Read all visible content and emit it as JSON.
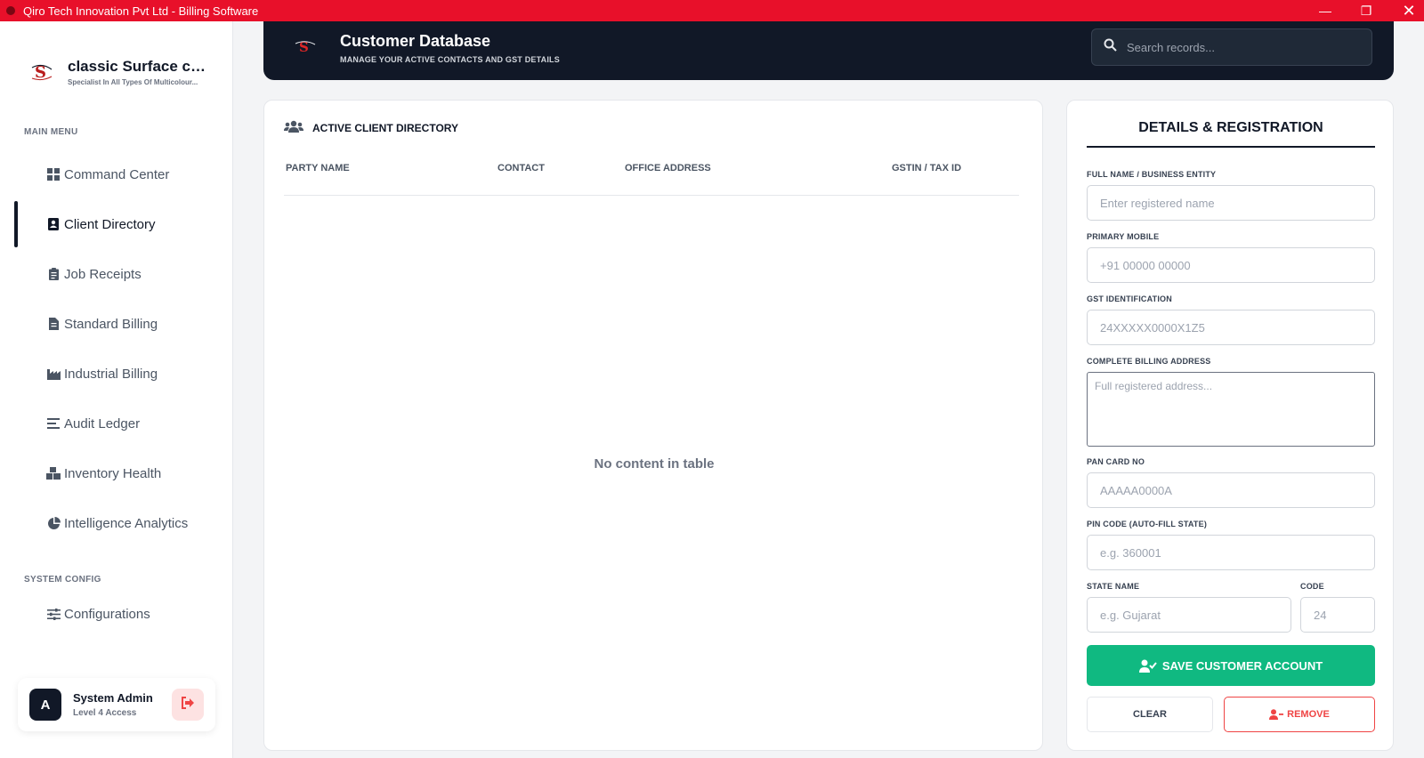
{
  "window": {
    "title": "Qiro Tech Innovation Pvt Ltd - Billing Software",
    "controls": [
      "minimize",
      "restore",
      "close"
    ]
  },
  "brand": {
    "name": "classic Surface co...",
    "tagline": "Specialist In All Types Of Multicolour..."
  },
  "sidebar": {
    "main_menu_label": "MAIN MENU",
    "system_config_label": "SYSTEM CONFIG",
    "items": [
      {
        "label": "Command Center",
        "icon": "grid-icon",
        "active": false
      },
      {
        "label": "Client Directory",
        "icon": "contact-card-icon",
        "active": true
      },
      {
        "label": "Job Receipts",
        "icon": "clipboard-icon",
        "active": false
      },
      {
        "label": "Standard Billing",
        "icon": "invoice-icon",
        "active": false
      },
      {
        "label": "Industrial Billing",
        "icon": "factory-icon",
        "active": false
      },
      {
        "label": "Audit Ledger",
        "icon": "list-icon",
        "active": false
      },
      {
        "label": "Inventory Health",
        "icon": "boxes-icon",
        "active": false
      },
      {
        "label": "Intelligence Analytics",
        "icon": "pie-chart-icon",
        "active": false
      }
    ],
    "config_items": [
      {
        "label": "Configurations",
        "icon": "sliders-icon"
      }
    ]
  },
  "user": {
    "initial": "A",
    "name": "System Admin",
    "level": "Level 4 Access"
  },
  "header": {
    "title": "Customer Database",
    "subtitle": "MANAGE YOUR ACTIVE CONTACTS AND GST DETAILS",
    "search_placeholder": "Search records..."
  },
  "table": {
    "title": "ACTIVE CLIENT DIRECTORY",
    "columns": [
      "PARTY NAME",
      "CONTACT",
      "OFFICE ADDRESS",
      "GSTIN / TAX ID"
    ],
    "rows": [],
    "empty_message": "No content in table"
  },
  "form": {
    "title": "DETAILS & REGISTRATION",
    "fields": {
      "name": {
        "label": "FULL NAME / BUSINESS ENTITY",
        "placeholder": "Enter registered name",
        "value": ""
      },
      "mobile": {
        "label": "PRIMARY MOBILE",
        "placeholder": "+91 00000 00000",
        "value": ""
      },
      "gst": {
        "label": "GST IDENTIFICATION",
        "placeholder": "24XXXXX0000X1Z5",
        "value": ""
      },
      "address": {
        "label": "COMPLETE BILLING ADDRESS",
        "placeholder": "Full registered address...",
        "value": ""
      },
      "pan": {
        "label": "PAN CARD NO",
        "placeholder": "AAAAA0000A",
        "value": ""
      },
      "pin": {
        "label": "PIN CODE (AUTO-FILL STATE)",
        "placeholder": "e.g. 360001",
        "value": ""
      },
      "state": {
        "label": "STATE NAME",
        "placeholder": "e.g. Gujarat",
        "value": ""
      },
      "code": {
        "label": "CODE",
        "placeholder": "24",
        "value": ""
      }
    },
    "save_label": "SAVE CUSTOMER ACCOUNT",
    "clear_label": "CLEAR",
    "remove_label": "REMOVE"
  },
  "colors": {
    "titlebar": "#e8102a",
    "dark": "#111827",
    "save": "#10b981",
    "danger": "#ef4444"
  }
}
